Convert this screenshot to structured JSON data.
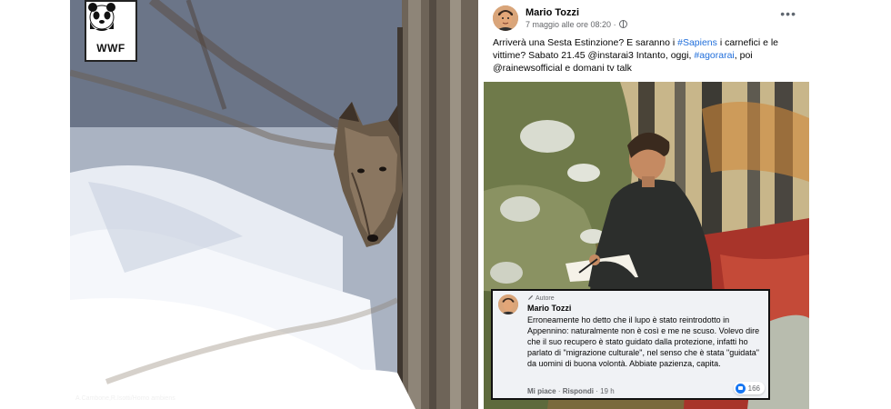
{
  "left_photo": {
    "logo_text": "WWF",
    "credit": "A.Cambone,R.Isotti/Homo ambiens"
  },
  "post": {
    "author": "Mario Tozzi",
    "date": "7 maggio alle ore 08:20",
    "date_separator": "·",
    "more_label": "•••",
    "text_parts": {
      "p1": "Arriverà una Sesta Estinzione? E saranno i ",
      "tag1": "#Sapiens",
      "p2": " i carnefici e le vittime? Sabato 21.45 @instarai3 Intanto, oggi, ",
      "tag2": "#agorarai",
      "p3": ", poi @rainewsofficial e domani tv talk"
    }
  },
  "comment": {
    "badge": "Autore",
    "author": "Mario Tozzi",
    "text": "Erroneamente ho detto che il lupo è stato reintrodotto in Appennino: naturalmente non è così e me ne scuso. Volevo dire che il suo recupero è stato guidato dalla protezione, infatti ho parlato di \"migrazione culturale\", nel senso che è stata \"guidata\" da uomini di buona volontà. Abbiate pazienza, capita.",
    "like_label": "Mi piace",
    "dot": "·",
    "reply_label": "Rispondi",
    "time": "19 h",
    "reaction_count": "166"
  },
  "icons": {
    "avatar": "person-avatar",
    "globe": "globe-icon",
    "more": "more-options-icon",
    "pencil": "pencil-icon",
    "like": "like-icon",
    "logo": "panda-logo"
  },
  "colors": {
    "hashtag": "#216fdb",
    "like_blue": "#1877f2",
    "muted": "#65676b"
  }
}
